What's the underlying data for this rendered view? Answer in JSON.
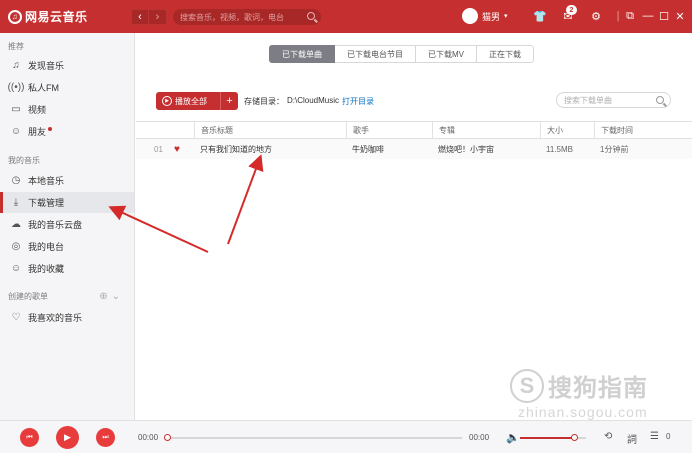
{
  "titlebar": {
    "logo_text": "网易云音乐",
    "search_placeholder": "搜索音乐，视频，歌词，电台",
    "username": "猫男",
    "message_count": "2"
  },
  "sidebar": {
    "section_recommend": "推荐",
    "recommend_items": [
      {
        "label": "发现音乐",
        "icon": "music-note-icon"
      },
      {
        "label": "私人FM",
        "icon": "radio-icon"
      },
      {
        "label": "视频",
        "icon": "video-icon"
      },
      {
        "label": "朋友",
        "icon": "friends-icon"
      }
    ],
    "section_my_music": "我的音乐",
    "my_music_items": [
      {
        "label": "本地音乐",
        "icon": "clock-icon"
      },
      {
        "label": "下载管理",
        "icon": "download-icon",
        "active": true
      },
      {
        "label": "我的音乐云盘",
        "icon": "cloud-icon"
      },
      {
        "label": "我的电台",
        "icon": "podcast-icon"
      },
      {
        "label": "我的收藏",
        "icon": "collection-icon"
      }
    ],
    "section_playlists": "创建的歌单",
    "playlist_items": [
      {
        "label": "我喜欢的音乐",
        "icon": "heart-outline-icon"
      }
    ]
  },
  "main": {
    "tabs": [
      {
        "label": "已下载单曲",
        "active": true
      },
      {
        "label": "已下载电台节目"
      },
      {
        "label": "已下载MV"
      },
      {
        "label": "正在下载"
      }
    ],
    "play_all_label": "播放全部",
    "storage_label": "存储目录：",
    "storage_path": "D:\\CloudMusic",
    "open_dir_label": "打开目录",
    "search_placeholder": "搜索下载单曲",
    "table": {
      "headers": [
        "音乐标题",
        "歌手",
        "专辑",
        "大小",
        "下载时间"
      ],
      "rows": [
        {
          "index": "01",
          "title": "只有我们知道的地方",
          "artist": "牛奶咖啡",
          "album": "燃烧吧！小宇宙",
          "size": "11.5MB",
          "time": "1分钟前"
        }
      ]
    }
  },
  "player": {
    "current_time": "00:00",
    "total_time": "00:00",
    "progress": 0,
    "volume": 0.82,
    "playlist_count": "0"
  },
  "watermark": {
    "text": "搜狗指南",
    "url": "zhinan.sogou.com"
  },
  "colors": {
    "brand_red": "#c62f2f",
    "sidebar_bg": "#f5f5f7",
    "annotation_arrow": "#d42a2a"
  }
}
